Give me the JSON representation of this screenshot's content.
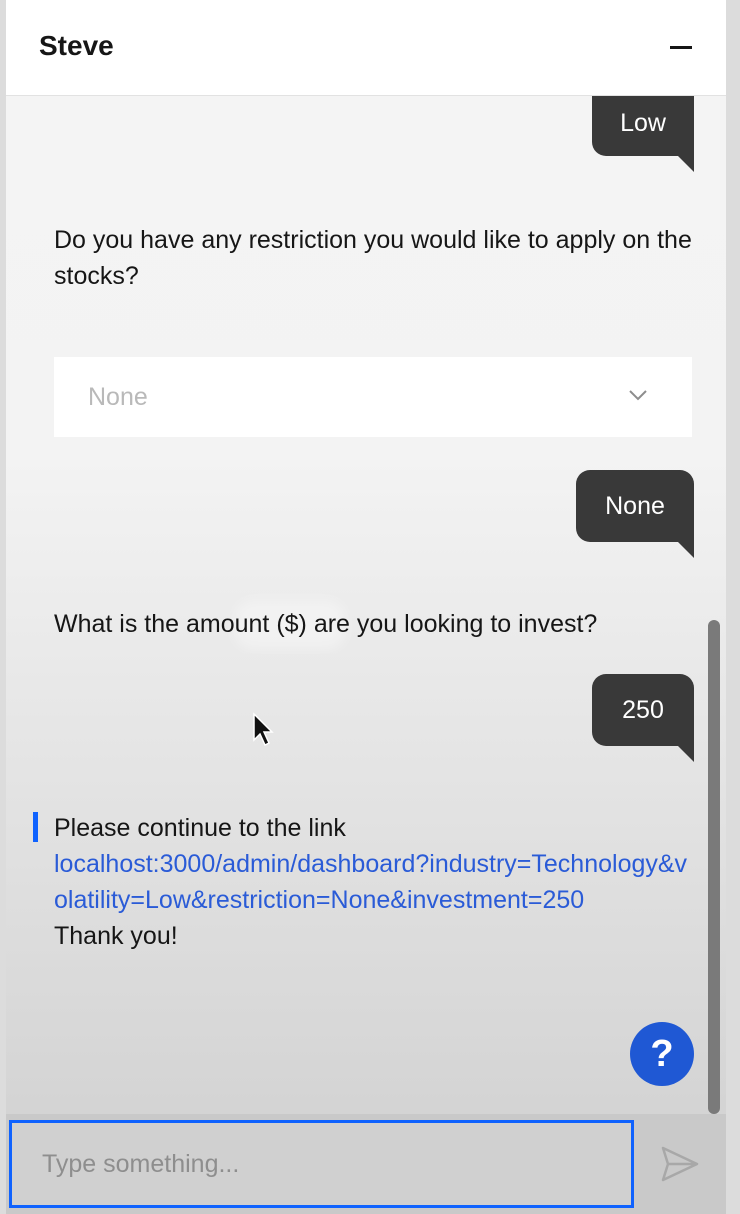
{
  "header": {
    "title": "Steve",
    "minimize_icon": "minus-icon"
  },
  "messages": {
    "user_volatility": "Low",
    "bot_restriction_question": "Do you have any restriction you would like to apply on the stocks?",
    "restriction_dropdown": {
      "selected": "None",
      "icon": "chevron-down-icon"
    },
    "user_restriction": "None",
    "bot_amount_question": "What is the amount ($) are you looking to invest?",
    "user_amount": "250",
    "bot_final": {
      "intro": "Please continue to the link",
      "link": "localhost:3000/admin/dashboard?industry=Technology&volatility=Low&restriction=None&investment=250",
      "outro": "Thank you!"
    }
  },
  "help_button": {
    "label": "?"
  },
  "composer": {
    "placeholder": "Type something...",
    "value": "",
    "send_icon": "send-icon"
  },
  "colors": {
    "accent": "#0f62fe",
    "bubble": "#393939",
    "link": "#2a5bd7",
    "help": "#1f58d4"
  }
}
